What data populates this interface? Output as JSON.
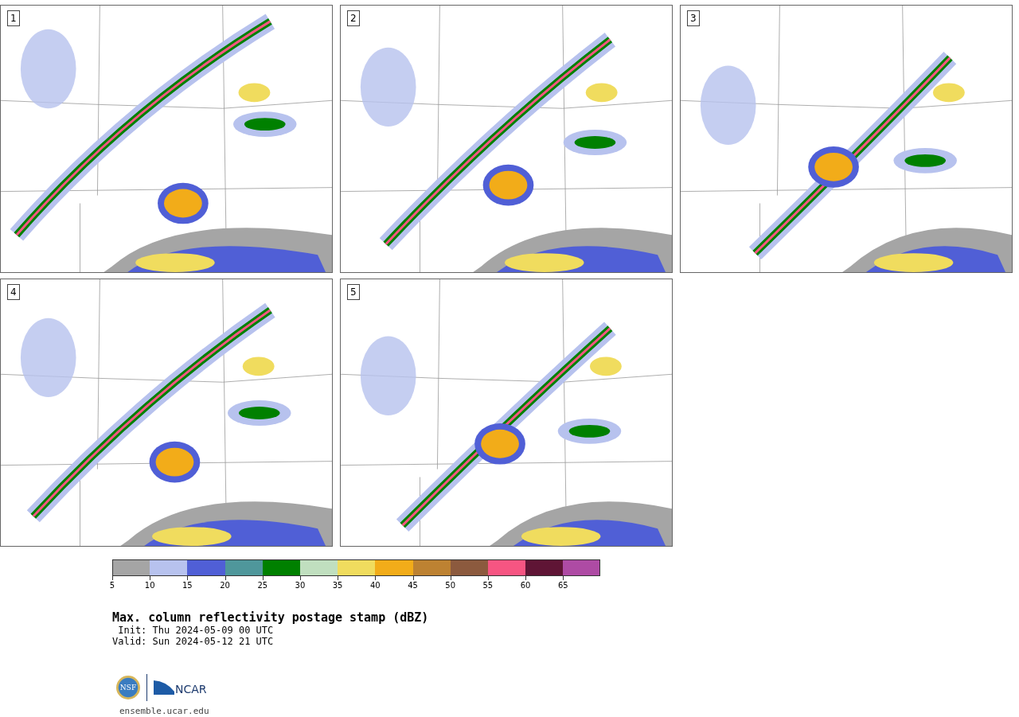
{
  "panels": [
    {
      "label": "1"
    },
    {
      "label": "2"
    },
    {
      "label": "3"
    },
    {
      "label": "4"
    },
    {
      "label": "5"
    }
  ],
  "colorbar": [
    {
      "color": "#a5a5a5",
      "tick": "5"
    },
    {
      "color": "#b7c2ee",
      "tick": "10"
    },
    {
      "color": "#505fd6",
      "tick": "15"
    },
    {
      "color": "#4f979b",
      "tick": "20"
    },
    {
      "color": "#008000",
      "tick": "25"
    },
    {
      "color": "#c0dfbf",
      "tick": "30"
    },
    {
      "color": "#f0dc5e",
      "tick": "35"
    },
    {
      "color": "#f2ac19",
      "tick": "40"
    },
    {
      "color": "#bd8232",
      "tick": "45"
    },
    {
      "color": "#8c5a3e",
      "tick": "50"
    },
    {
      "color": "#f65582",
      "tick": "55"
    },
    {
      "color": "#5f1535",
      "tick": "60"
    },
    {
      "color": "#ae4ba4",
      "tick": "65"
    }
  ],
  "title": "Max. column reflectivity postage stamp (dBZ)",
  "init": " Init: Thu 2024-05-09 00 UTC",
  "valid": "Valid: Sun 2024-05-12 21 UTC",
  "logos": {
    "nsf": "NSF",
    "ncar": "NCAR"
  },
  "site": "ensemble.ucar.edu"
}
